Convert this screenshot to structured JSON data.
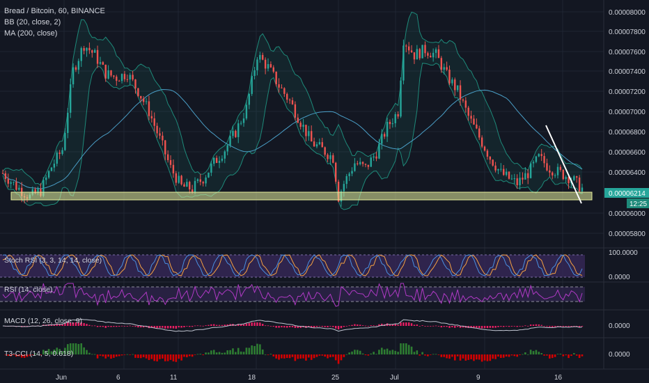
{
  "header": {
    "title": "Bread / Bitcoin, 60, BINANCE",
    "indicator_bb": "BB (20, close, 2)",
    "indicator_ma": "MA (200, close)"
  },
  "price_axis": {
    "ticks": [
      "0.00008000",
      "0.00007800",
      "0.00007600",
      "0.00007400",
      "0.00007200",
      "0.00007000",
      "0.00006800",
      "0.00006600",
      "0.00006400",
      "0.00006000",
      "0.00005800"
    ],
    "current_price": "0.00006214",
    "countdown": "12:25"
  },
  "panes": {
    "stoch": {
      "label": "Stoch RSI (3, 3, 14, 14, close)",
      "ticks": [
        "100.0000",
        "0.0000"
      ]
    },
    "rsi": {
      "label": "RSI (14, close)"
    },
    "macd": {
      "label": "MACD (12, 26, close, 9)",
      "ticks": [
        "0.0000"
      ]
    },
    "t3cci": {
      "label": "T3-CCI (14, 5, 0.618)",
      "ticks": [
        "0.0000"
      ]
    }
  },
  "time_axis": {
    "labels": [
      "Jun",
      "6",
      "11",
      "18",
      "25",
      "Jul",
      "9",
      "16"
    ]
  },
  "colors": {
    "background": "#131722",
    "candle_up": "#26a69a",
    "candle_down": "#ef5350",
    "support_zone": "#e6ee9c",
    "price_badge": "#26a69a",
    "trendline": "#ffffff",
    "ma": "#4a9ec6",
    "bb": "#1e8a7a",
    "stoch_fill": "#3a2a5c",
    "rsi_line": "#b13ac6",
    "macd_hist": "#e91e63",
    "cci_pos": "#2e7d32",
    "cci_neg": "#d50000"
  },
  "chart_data": {
    "type": "candlestick",
    "title": "Bread / Bitcoin, 60, BINANCE",
    "x_labels": [
      "Jun",
      "6",
      "11",
      "18",
      "25",
      "Jul",
      "9",
      "16"
    ],
    "ylim": [
      5.75e-05,
      8.1e-05
    ],
    "close_path": [
      [
        0,
        6.45e-05
      ],
      [
        5,
        6.32e-05
      ],
      [
        10,
        6.22e-05
      ],
      [
        14,
        6.28e-05
      ],
      [
        18,
        6.51e-05
      ],
      [
        22,
        6.68e-05
      ],
      [
        26,
        7.45e-05
      ],
      [
        30,
        7.7e-05
      ],
      [
        34,
        7.6e-05
      ],
      [
        38,
        7.42e-05
      ],
      [
        42,
        7.38e-05
      ],
      [
        46,
        7.42e-05
      ],
      [
        50,
        7.25e-05
      ],
      [
        54,
        7.05e-05
      ],
      [
        58,
        6.78e-05
      ],
      [
        62,
        6.5e-05
      ],
      [
        66,
        6.32e-05
      ],
      [
        70,
        6.3e-05
      ],
      [
        74,
        6.4e-05
      ],
      [
        78,
        6.55e-05
      ],
      [
        82,
        6.68e-05
      ],
      [
        86,
        6.85e-05
      ],
      [
        90,
        7.08e-05
      ],
      [
        94,
        7.6e-05
      ],
      [
        98,
        7.48e-05
      ],
      [
        102,
        7.3e-05
      ],
      [
        106,
        7.15e-05
      ],
      [
        110,
        6.95e-05
      ],
      [
        114,
        6.75e-05
      ],
      [
        118,
        6.68e-05
      ],
      [
        122,
        6.6e-05
      ],
      [
        124,
        6.22e-05
      ],
      [
        126,
        6.35e-05
      ],
      [
        130,
        6.55e-05
      ],
      [
        134,
        6.5e-05
      ],
      [
        138,
        6.65e-05
      ],
      [
        142,
        6.9e-05
      ],
      [
        146,
        7.05e-05
      ],
      [
        148,
        7.75e-05
      ],
      [
        152,
        7.6e-05
      ],
      [
        156,
        7.65e-05
      ],
      [
        160,
        7.6e-05
      ],
      [
        164,
        7.4e-05
      ],
      [
        168,
        7.25e-05
      ],
      [
        172,
        7e-05
      ],
      [
        176,
        6.8e-05
      ],
      [
        180,
        6.6e-05
      ],
      [
        184,
        6.45e-05
      ],
      [
        188,
        6.38e-05
      ],
      [
        190,
        6.35e-05
      ],
      [
        194,
        6.45e-05
      ],
      [
        198,
        6.6e-05
      ],
      [
        202,
        6.5e-05
      ],
      [
        206,
        6.45e-05
      ],
      [
        210,
        6.4e-05
      ],
      [
        214,
        6.3e-05
      ]
    ],
    "support_zone": [
      6.18e-05,
      6.26e-05
    ],
    "last_price": 6.214e-05
  }
}
